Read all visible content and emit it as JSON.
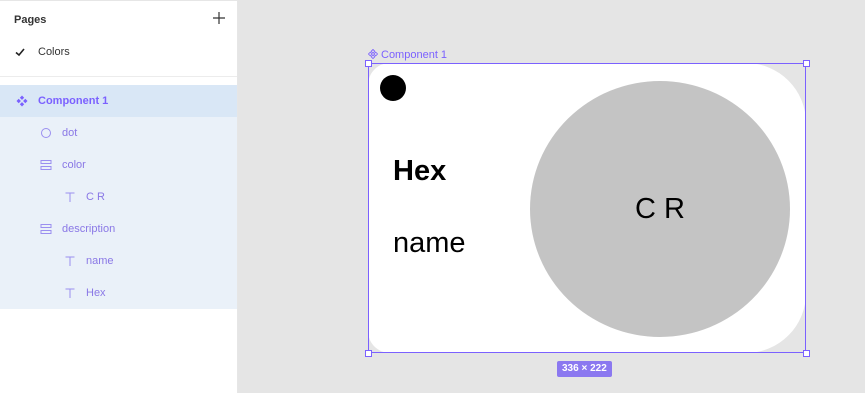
{
  "pages": {
    "title": "Pages",
    "items": [
      {
        "label": "Colors",
        "selected": true
      }
    ]
  },
  "layers": [
    {
      "label": "Component 1",
      "icon": "component-icon",
      "level": 0
    },
    {
      "label": "dot",
      "icon": "ellipse-icon",
      "level": 1
    },
    {
      "label": "color",
      "icon": "auto-layout-icon",
      "level": 1
    },
    {
      "label": "C R",
      "icon": "text-icon",
      "level": 2
    },
    {
      "label": "description",
      "icon": "auto-layout-icon",
      "level": 1
    },
    {
      "label": "name",
      "icon": "text-icon",
      "level": 2
    },
    {
      "label": "Hex",
      "icon": "text-icon",
      "level": 2
    }
  ],
  "canvas": {
    "frame_label": "Component 1",
    "card": {
      "hex": "Hex",
      "name": "name",
      "color_code": "C R",
      "circle_color": "#c4c4c4"
    },
    "size_badge": "336 × 222"
  },
  "colors": {
    "accent": "#7b61ff",
    "selected_row": "#d9e7f6",
    "layers_bg": "#eaf1f9"
  }
}
